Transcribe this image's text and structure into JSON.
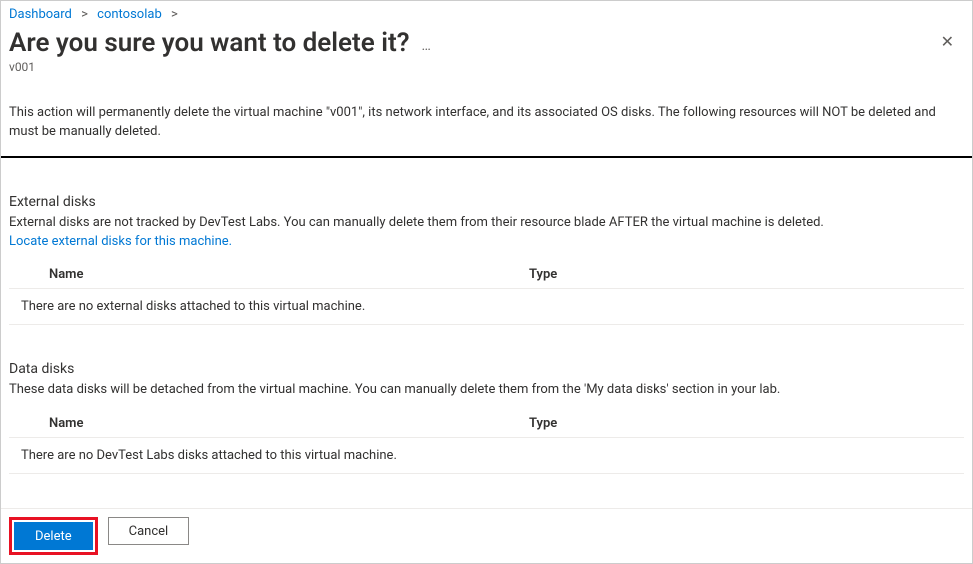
{
  "breadcrumb": {
    "dashboard": "Dashboard",
    "lab": "contosolab"
  },
  "header": {
    "title": "Are you sure you want to delete it?",
    "subtitle": "v001"
  },
  "warning": "This action will permanently delete the virtual machine \"v001\", its network interface, and its associated OS disks. The following resources will NOT be deleted and must be manually deleted.",
  "externalDisks": {
    "title": "External disks",
    "desc": "External disks are not tracked by DevTest Labs. You can manually delete them from their resource blade AFTER the virtual machine is deleted.",
    "link": "Locate external disks for this machine.",
    "columns": {
      "name": "Name",
      "type": "Type"
    },
    "emptyMessage": "There are no external disks attached to this virtual machine."
  },
  "dataDisks": {
    "title": "Data disks",
    "desc": "These data disks will be detached from the virtual machine. You can manually delete them from the 'My data disks' section in your lab.",
    "columns": {
      "name": "Name",
      "type": "Type"
    },
    "emptyMessage": "There are no DevTest Labs disks attached to this virtual machine."
  },
  "footer": {
    "delete": "Delete",
    "cancel": "Cancel"
  }
}
